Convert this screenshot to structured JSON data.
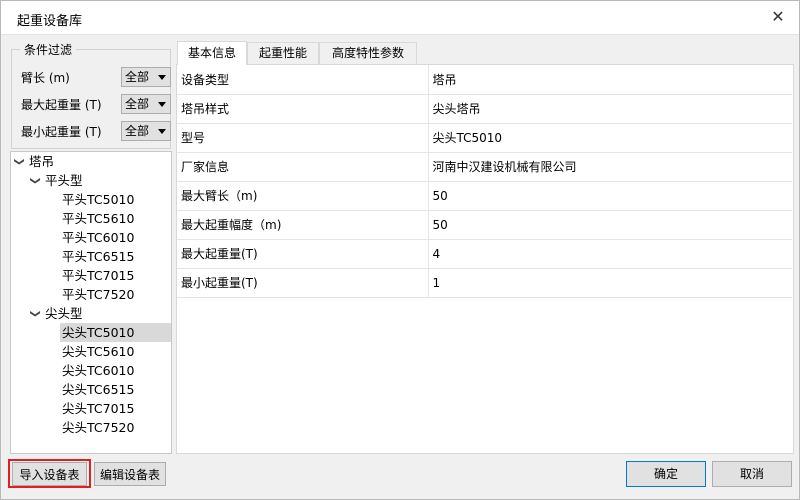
{
  "window": {
    "title": "起重设备库"
  },
  "filter": {
    "group_title": "条件过滤",
    "rows": [
      {
        "label": "臂长 (m)",
        "value": "全部"
      },
      {
        "label": "最大起重量 (T)",
        "value": "全部"
      },
      {
        "label": "最小起重量 (T)",
        "value": "全部"
      }
    ]
  },
  "tree": {
    "root": "塔吊",
    "groups": [
      {
        "label": "平头型",
        "items": [
          "平头TC5010",
          "平头TC5610",
          "平头TC6010",
          "平头TC6515",
          "平头TC7015",
          "平头TC7520"
        ]
      },
      {
        "label": "尖头型",
        "items": [
          "尖头TC5010",
          "尖头TC5610",
          "尖头TC6010",
          "尖头TC6515",
          "尖头TC7015",
          "尖头TC7520"
        ]
      }
    ],
    "selected": "尖头TC5010"
  },
  "tabs": [
    "基本信息",
    "起重性能",
    "高度特性参数"
  ],
  "properties": [
    {
      "key": "设备类型",
      "value": "塔吊"
    },
    {
      "key": "塔吊样式",
      "value": "尖头塔吊"
    },
    {
      "key": "型号",
      "value": "尖头TC5010"
    },
    {
      "key": "厂家信息",
      "value": "河南中汉建设机械有限公司"
    },
    {
      "key": "最大臂长（m)",
      "value": "50"
    },
    {
      "key": "最大起重幅度（m)",
      "value": "50"
    },
    {
      "key": "最大起重量(T)",
      "value": "4"
    },
    {
      "key": "最小起重量(T)",
      "value": "1"
    }
  ],
  "buttons": {
    "import": "导入设备表",
    "edit": "编辑设备表",
    "ok": "确定",
    "cancel": "取消"
  },
  "colors": {
    "highlight": "#e02020",
    "selected_row": "#d9d9d9"
  }
}
